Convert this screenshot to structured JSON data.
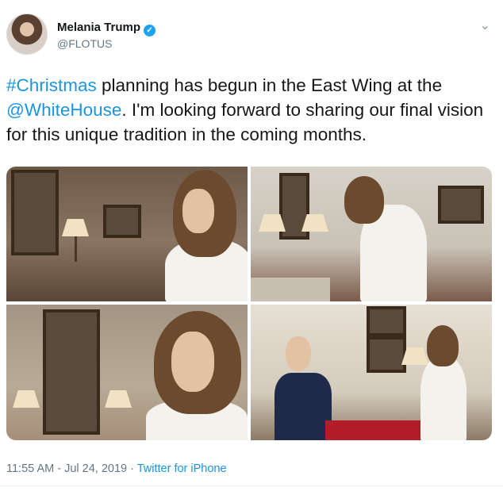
{
  "author": {
    "name": "Melania Trump",
    "handle": "@FLOTUS",
    "verified_icon": "verified-badge-icon"
  },
  "tweet": {
    "hashtag": "#Christmas",
    "text_part1": " planning has begun in the East Wing at the ",
    "mention": "@WhiteHouse",
    "text_part2": ". I'm looking forward to sharing our final vision for this unique tradition in the coming months."
  },
  "footer": {
    "time": "11:55 AM",
    "separator": " · ",
    "date": "Jul 24, 2019",
    "source": "Twitter for iPhone"
  },
  "icons": {
    "caret": "chevron-down-icon",
    "verified_check": "✓"
  },
  "colors": {
    "link": "#1b95e0",
    "verified": "#1da1f2",
    "meta": "#657786"
  }
}
